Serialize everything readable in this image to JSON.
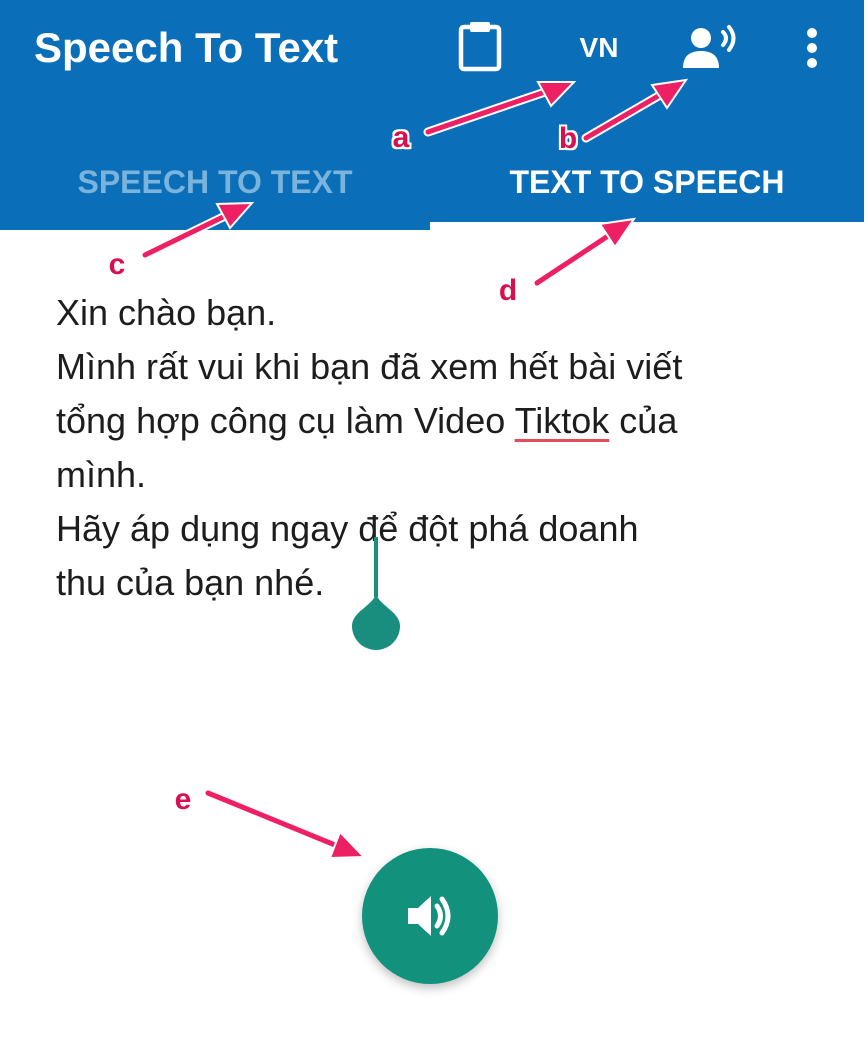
{
  "app": {
    "title": "Speech To Text"
  },
  "toolbar": {
    "clipboard_icon": "clipboard-icon",
    "language_label": "VN",
    "voice_icon": "record-voice-icon",
    "more_icon": "more-vertical-icon"
  },
  "tabs": [
    {
      "label": "SPEECH TO TEXT",
      "selected": false
    },
    {
      "label": "TEXT TO SPEECH",
      "selected": true
    }
  ],
  "editor": {
    "lines": [
      "Xin chào bạn.",
      "Mình rất vui khi bạn đã xem hết bài viết",
      "tổng hợp công cụ làm Video ",
      "Tiktok",
      " của",
      "mình.",
      "Hãy áp dụng ngay để đột phá doanh",
      "thu của bạn nhé."
    ]
  },
  "fab": {
    "icon": "volume-up-icon"
  },
  "annotations": [
    "a",
    "b",
    "c",
    "d",
    "e"
  ],
  "colors": {
    "appbar": "#0a6fb8",
    "tab_inactive": "#7ab3dc",
    "accent": "#12917c",
    "annotation": "#ee1f63"
  }
}
